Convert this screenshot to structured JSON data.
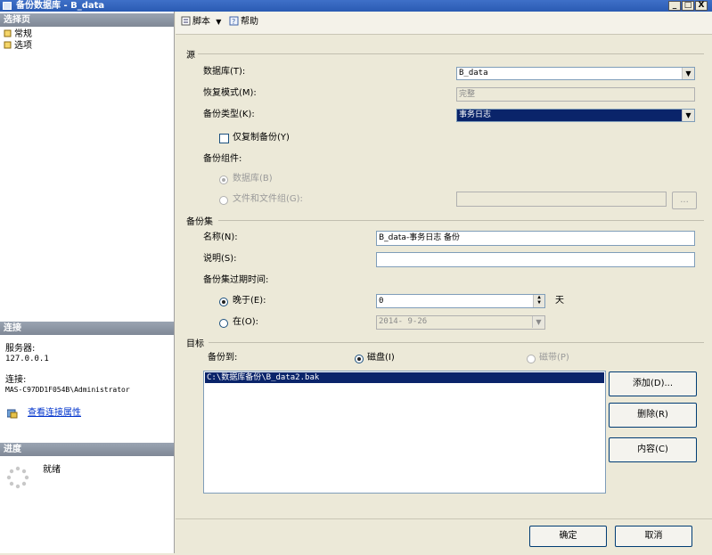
{
  "window": {
    "title": "备份数据库 - B_data",
    "controls": [
      "_",
      "□",
      "X"
    ]
  },
  "sidebar": {
    "select_page_header": "选择页",
    "pages": [
      {
        "label": "常规"
      },
      {
        "label": "选项"
      }
    ],
    "connection_header": "连接",
    "server_label": "服务器:",
    "server_value": "127.0.0.1",
    "connection_label": "连接:",
    "connection_value": "MAS-C97DD1F054B\\Administrator",
    "view_connection_link": "查看连接属性",
    "progress_header": "进度",
    "progress_status": "就绪"
  },
  "toolbar": {
    "script_label": "脚本",
    "help_label": "帮助"
  },
  "source": {
    "group_title": "源",
    "database_label": "数据库(T):",
    "database_value": "B_data",
    "recovery_label": "恢复模式(M):",
    "recovery_value": "完整",
    "backup_type_label": "备份类型(K):",
    "backup_type_value": "事务日志",
    "copy_only_label": "仅复制备份(Y)",
    "component_label": "备份组件:",
    "component_database": "数据库(B)",
    "component_files": "文件和文件组(G):",
    "files_browse": "..."
  },
  "backup_set": {
    "group_title": "备份集",
    "name_label": "名称(N):",
    "name_value": "B_data-事务日志 备份",
    "description_label": "说明(S):",
    "description_value": "",
    "expire_label": "备份集过期时间:",
    "after_label": "晚于(E):",
    "after_value": "0",
    "days_unit": "天",
    "on_label": "在(O):",
    "on_value": "2014- 9-26"
  },
  "destination": {
    "group_title": "目标",
    "backup_to_label": "备份到:",
    "disk_label": "磁盘(I)",
    "tape_label": "磁带(P)",
    "files": [
      "C:\\数据库备份\\B_data2.bak"
    ],
    "add_button": "添加(D)...",
    "remove_button": "删除(R)",
    "contents_button": "内容(C)"
  },
  "footer": {
    "ok_button": "确定",
    "cancel_button": "取消"
  }
}
